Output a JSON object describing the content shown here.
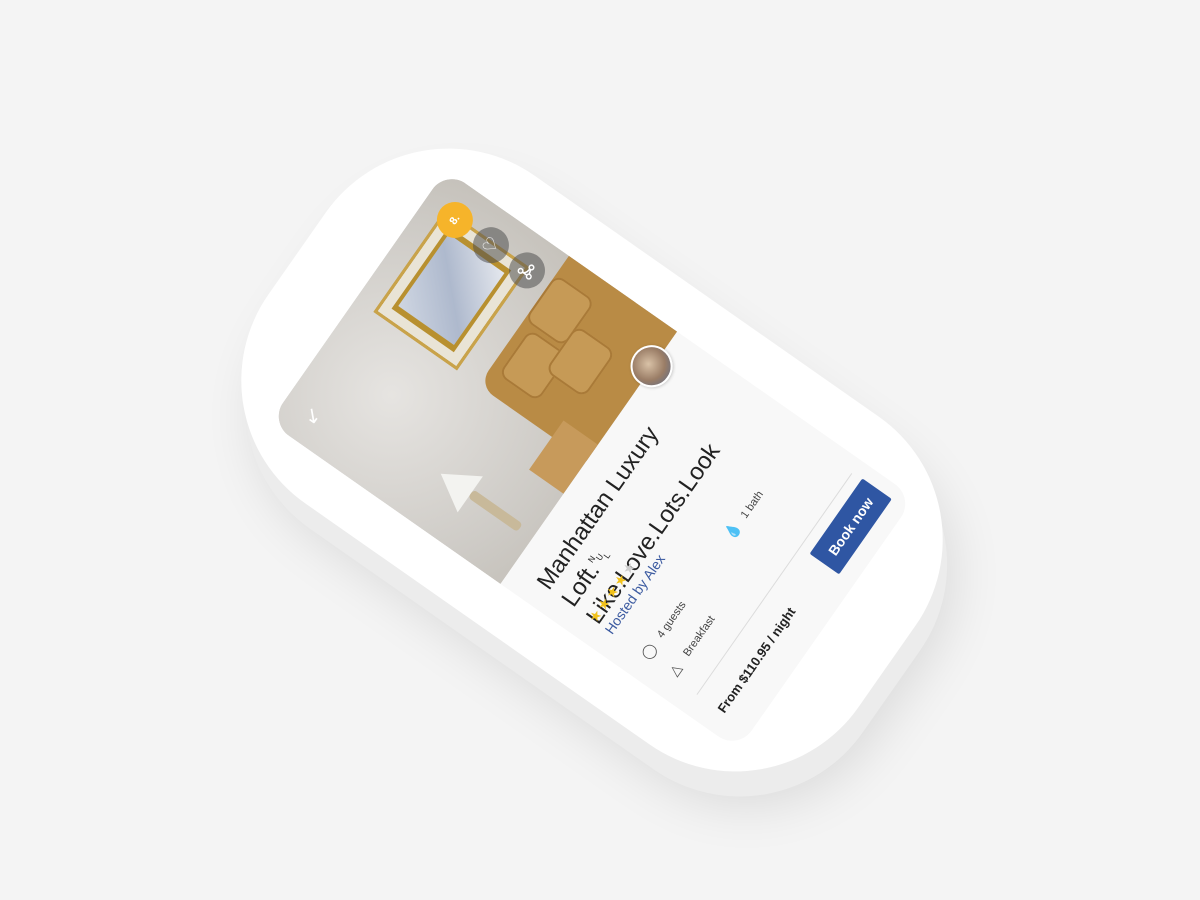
{
  "listing": {
    "badge": "8.",
    "title": "Manhattan Luxury Loft.␀ Like.Love.Lots.Look",
    "rating": 4,
    "rating_max": 5,
    "host_text": "Hosted by Alex",
    "features": {
      "guests": "4 guests",
      "bath": "1 bath",
      "breakfast": "Breakfast"
    },
    "price_text": "From $110.95 / night",
    "book_label": "Book now"
  },
  "colors": {
    "accent": "#2f56a3",
    "badge": "#f6b42a",
    "star": "#f2c21b"
  },
  "icons": {
    "back": "arrow-back-icon",
    "heart": "heart-icon",
    "share": "share-icon",
    "guests": "person-icon",
    "bath": "water-drop-icon",
    "breakfast": "cloche-icon"
  }
}
